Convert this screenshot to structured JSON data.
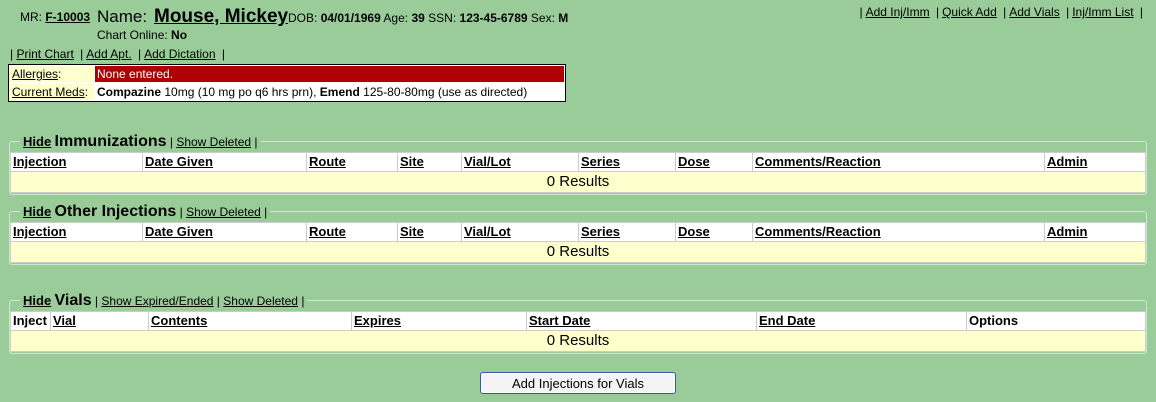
{
  "patient": {
    "mr_label": "MR:",
    "mr_value": "F-10003",
    "name_label": "Name:",
    "name_value": "Mouse, Mickey",
    "dob_label": "DOB:",
    "dob_value": "04/01/1969",
    "age_label": "Age:",
    "age_value": "39",
    "ssn_label": "SSN:",
    "ssn_value": "123-45-6789",
    "sex_label": "Sex:",
    "sex_value": "M",
    "chart_online_label": "Chart Online:",
    "chart_online_value": "No"
  },
  "top_links": {
    "add_inj": "Add Inj/Imm",
    "quick_add": "Quick Add",
    "add_vials": "Add Vials",
    "inj_list": "Inj/Imm List"
  },
  "actions": {
    "print_chart": "Print Chart",
    "add_apt": "Add Apt.",
    "add_dictation": "Add Dictation"
  },
  "info": {
    "allergies_label": "Allergies",
    "allergies_value": "None entered.",
    "meds_label": "Current Meds",
    "med1_name": "Compazine",
    "med1_detail": "10mg (10 mg po q6 hrs prn),",
    "med2_name": "Emend",
    "med2_detail": "125-80-80mg (use as directed)"
  },
  "immunizations": {
    "hide": "Hide",
    "title": "Immunizations",
    "show_deleted": "Show Deleted",
    "columns": [
      "Injection",
      "Date Given",
      "Route",
      "Site",
      "Vial/Lot",
      "Series",
      "Dose",
      "Comments/Reaction",
      "Admin"
    ],
    "results": "0 Results"
  },
  "other_injections": {
    "hide": "Hide",
    "title": "Other Injections",
    "show_deleted": "Show Deleted",
    "columns": [
      "Injection",
      "Date Given",
      "Route",
      "Site",
      "Vial/Lot",
      "Series",
      "Dose",
      "Comments/Reaction",
      "Admin"
    ],
    "results": "0 Results"
  },
  "vials": {
    "hide": "Hide",
    "title": "Vials",
    "show_expired": "Show Expired/Ended",
    "show_deleted": "Show Deleted",
    "columns": [
      "Inject",
      "Vial",
      "Contents",
      "Expires",
      "Start Date",
      "End Date",
      "Options"
    ],
    "results": "0 Results"
  },
  "buttons": {
    "add_injections_for_vials": "Add Injections for Vials"
  }
}
